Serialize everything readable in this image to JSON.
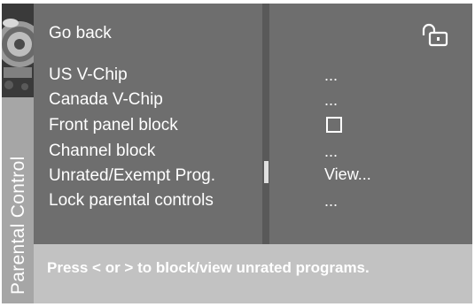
{
  "sidebar": {
    "title": "Parental Control"
  },
  "menu": {
    "items": [
      {
        "label": "Go back",
        "value": ""
      },
      {
        "label": "US V-Chip",
        "value": "..."
      },
      {
        "label": "Canada V-Chip",
        "value": "..."
      },
      {
        "label": "Front panel block",
        "value": "",
        "checked": false
      },
      {
        "label": "Channel block",
        "value": "..."
      },
      {
        "label": "Unrated/Exempt Prog.",
        "value": "View..."
      },
      {
        "label": "Lock parental controls",
        "value": "..."
      }
    ],
    "selected_index": 5
  },
  "status": {
    "lock_icon": "unlocked-padlock-icon",
    "locked": false
  },
  "help": {
    "text": "Press < or > to block/view unrated programs."
  },
  "colors": {
    "panel": "#6e6e6e",
    "help_bar": "#c2c2c2",
    "side_strip": "#a6a6a6",
    "text": "#ffffff"
  }
}
